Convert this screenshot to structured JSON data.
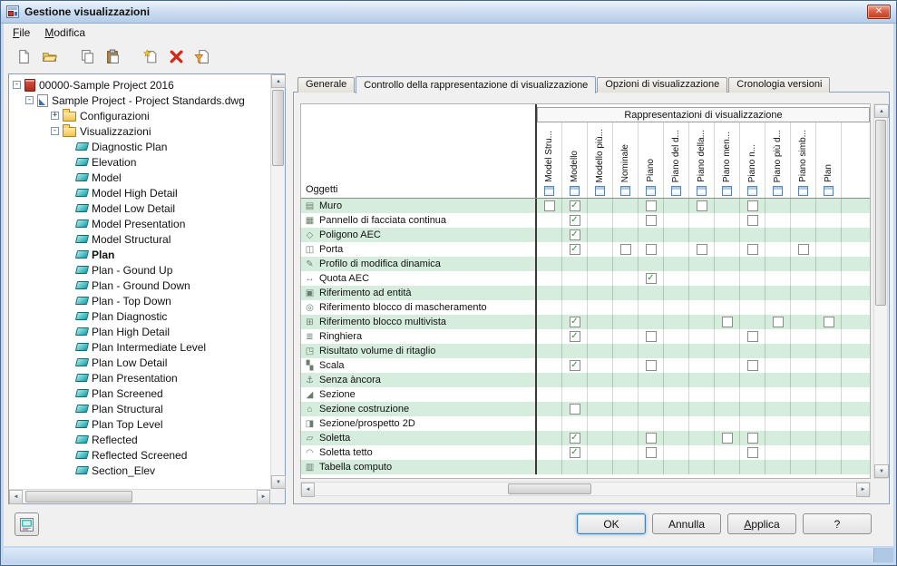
{
  "window": {
    "title": "Gestione visualizzazioni",
    "close_glyph": "✕"
  },
  "menubar": {
    "items": [
      "File",
      "Modifica"
    ]
  },
  "toolbar": {
    "icons": [
      "new",
      "open",
      "copy",
      "paste",
      "new-item",
      "delete",
      "purge"
    ]
  },
  "tree": {
    "items": [
      {
        "label": "00000-Sample Project 2016",
        "level": 0,
        "icon": "project",
        "expander": "-"
      },
      {
        "label": "Sample Project - Project Standards.dwg",
        "level": 1,
        "icon": "dwg",
        "expander": "-"
      },
      {
        "label": "Configurazioni",
        "level": 2,
        "icon": "folder",
        "expander": "+"
      },
      {
        "label": "Visualizzazioni",
        "level": 2,
        "icon": "folder",
        "expander": "-"
      },
      {
        "label": "Diagnostic Plan",
        "level": 3,
        "icon": "display"
      },
      {
        "label": "Elevation",
        "level": 3,
        "icon": "display"
      },
      {
        "label": "Model",
        "level": 3,
        "icon": "display"
      },
      {
        "label": "Model High Detail",
        "level": 3,
        "icon": "display"
      },
      {
        "label": "Model Low Detail",
        "level": 3,
        "icon": "display"
      },
      {
        "label": "Model Presentation",
        "level": 3,
        "icon": "display"
      },
      {
        "label": "Model Structural",
        "level": 3,
        "icon": "display"
      },
      {
        "label": "Plan",
        "level": 3,
        "icon": "display",
        "bold": true
      },
      {
        "label": "Plan - Gound Up",
        "level": 3,
        "icon": "display"
      },
      {
        "label": "Plan - Ground Down",
        "level": 3,
        "icon": "display"
      },
      {
        "label": "Plan - Top Down",
        "level": 3,
        "icon": "display"
      },
      {
        "label": "Plan Diagnostic",
        "level": 3,
        "icon": "display"
      },
      {
        "label": "Plan High Detail",
        "level": 3,
        "icon": "display"
      },
      {
        "label": "Plan Intermediate Level",
        "level": 3,
        "icon": "display"
      },
      {
        "label": "Plan Low Detail",
        "level": 3,
        "icon": "display"
      },
      {
        "label": "Plan Presentation",
        "level": 3,
        "icon": "display"
      },
      {
        "label": "Plan Screened",
        "level": 3,
        "icon": "display"
      },
      {
        "label": "Plan Structural",
        "level": 3,
        "icon": "display"
      },
      {
        "label": "Plan Top Level",
        "level": 3,
        "icon": "display"
      },
      {
        "label": "Reflected",
        "level": 3,
        "icon": "display"
      },
      {
        "label": "Reflected Screened",
        "level": 3,
        "icon": "display"
      },
      {
        "label": "Section_Elev",
        "level": 3,
        "icon": "display"
      }
    ]
  },
  "tabs": {
    "items": [
      {
        "label": "Generale",
        "active": false
      },
      {
        "label": "Controllo della rappresentazione di visualizzazione",
        "active": true
      },
      {
        "label": "Opzioni di visualizzazione",
        "active": false
      },
      {
        "label": "Cronologia versioni",
        "active": false
      }
    ]
  },
  "table": {
    "group_header": "Rappresentazioni di visualizzazione",
    "row_header": "Oggetti",
    "columns": [
      "Model Stru...",
      "Modello",
      "Modello più...",
      "Nominale",
      "Piano",
      "Piano del d...",
      "Piano della...",
      "Piano men...",
      "Piano n...",
      "Piano più d...",
      "Piano simb...",
      "Plan"
    ],
    "rows": [
      {
        "label": "Muro",
        "icon": "▤",
        "cells": [
          "u",
          "c",
          "",
          "",
          "u",
          "",
          "u",
          "",
          "u",
          "",
          "",
          ""
        ]
      },
      {
        "label": "Pannello di facciata continua",
        "icon": "▦",
        "cells": [
          "",
          "c",
          "",
          "",
          "u",
          "",
          "",
          "",
          "u",
          "",
          "",
          ""
        ]
      },
      {
        "label": "Poligono AEC",
        "icon": "◇",
        "cells": [
          "",
          "c",
          "",
          "",
          "",
          "",
          "",
          "",
          "",
          "",
          "",
          ""
        ]
      },
      {
        "label": "Porta",
        "icon": "◫",
        "cells": [
          "",
          "c",
          "",
          "u",
          "u",
          "",
          "u",
          "",
          "u",
          "",
          "u",
          ""
        ]
      },
      {
        "label": "Profilo di modifica dinamica",
        "icon": "✎",
        "cells": [
          "",
          "",
          "",
          "",
          "",
          "",
          "",
          "",
          "",
          "",
          "",
          ""
        ]
      },
      {
        "label": "Quota AEC",
        "icon": "↔",
        "cells": [
          "",
          "",
          "",
          "",
          "c",
          "",
          "",
          "",
          "",
          "",
          "",
          ""
        ]
      },
      {
        "label": "Riferimento ad entità",
        "icon": "▣",
        "cells": [
          "",
          "",
          "",
          "",
          "",
          "",
          "",
          "",
          "",
          "",
          "",
          ""
        ]
      },
      {
        "label": "Riferimento blocco di mascheramento",
        "icon": "◎",
        "cells": [
          "",
          "",
          "",
          "",
          "",
          "",
          "",
          "",
          "",
          "",
          "",
          ""
        ]
      },
      {
        "label": "Riferimento blocco multivista",
        "icon": "⊞",
        "cells": [
          "",
          "c",
          "",
          "",
          "",
          "",
          "",
          "u",
          "",
          "u",
          "",
          "u"
        ]
      },
      {
        "label": "Ringhiera",
        "icon": "≣",
        "cells": [
          "",
          "c",
          "",
          "",
          "u",
          "",
          "",
          "",
          "u",
          "",
          "",
          ""
        ]
      },
      {
        "label": "Risultato volume di ritaglio",
        "icon": "◳",
        "cells": [
          "",
          "",
          "",
          "",
          "",
          "",
          "",
          "",
          "",
          "",
          "",
          ""
        ]
      },
      {
        "label": "Scala",
        "icon": "▚",
        "cells": [
          "",
          "c",
          "",
          "",
          "u",
          "",
          "",
          "",
          "u",
          "",
          "",
          ""
        ]
      },
      {
        "label": "Senza àncora",
        "icon": "⚓",
        "cells": [
          "",
          "",
          "",
          "",
          "",
          "",
          "",
          "",
          "",
          "",
          "",
          ""
        ]
      },
      {
        "label": "Sezione",
        "icon": "◢",
        "cells": [
          "",
          "",
          "",
          "",
          "",
          "",
          "",
          "",
          "",
          "",
          "",
          ""
        ]
      },
      {
        "label": "Sezione costruzione",
        "icon": "⌂",
        "cells": [
          "",
          "u",
          "",
          "",
          "",
          "",
          "",
          "",
          "",
          "",
          "",
          ""
        ]
      },
      {
        "label": "Sezione/prospetto 2D",
        "icon": "◨",
        "cells": [
          "",
          "",
          "",
          "",
          "",
          "",
          "",
          "",
          "",
          "",
          "",
          ""
        ]
      },
      {
        "label": "Soletta",
        "icon": "▱",
        "cells": [
          "",
          "c",
          "",
          "",
          "u",
          "",
          "",
          "u",
          "u",
          "",
          "",
          ""
        ]
      },
      {
        "label": "Soletta tetto",
        "icon": "◠",
        "cells": [
          "",
          "c",
          "",
          "",
          "u",
          "",
          "",
          "",
          "u",
          "",
          "",
          ""
        ]
      },
      {
        "label": "Tabella computo",
        "icon": "▥",
        "cells": [
          "",
          "",
          "",
          "",
          "",
          "",
          "",
          "",
          "",
          "",
          "",
          ""
        ]
      }
    ]
  },
  "footer": {
    "ok": "OK",
    "cancel": "Annulla",
    "apply": "Applica",
    "help": "?"
  }
}
